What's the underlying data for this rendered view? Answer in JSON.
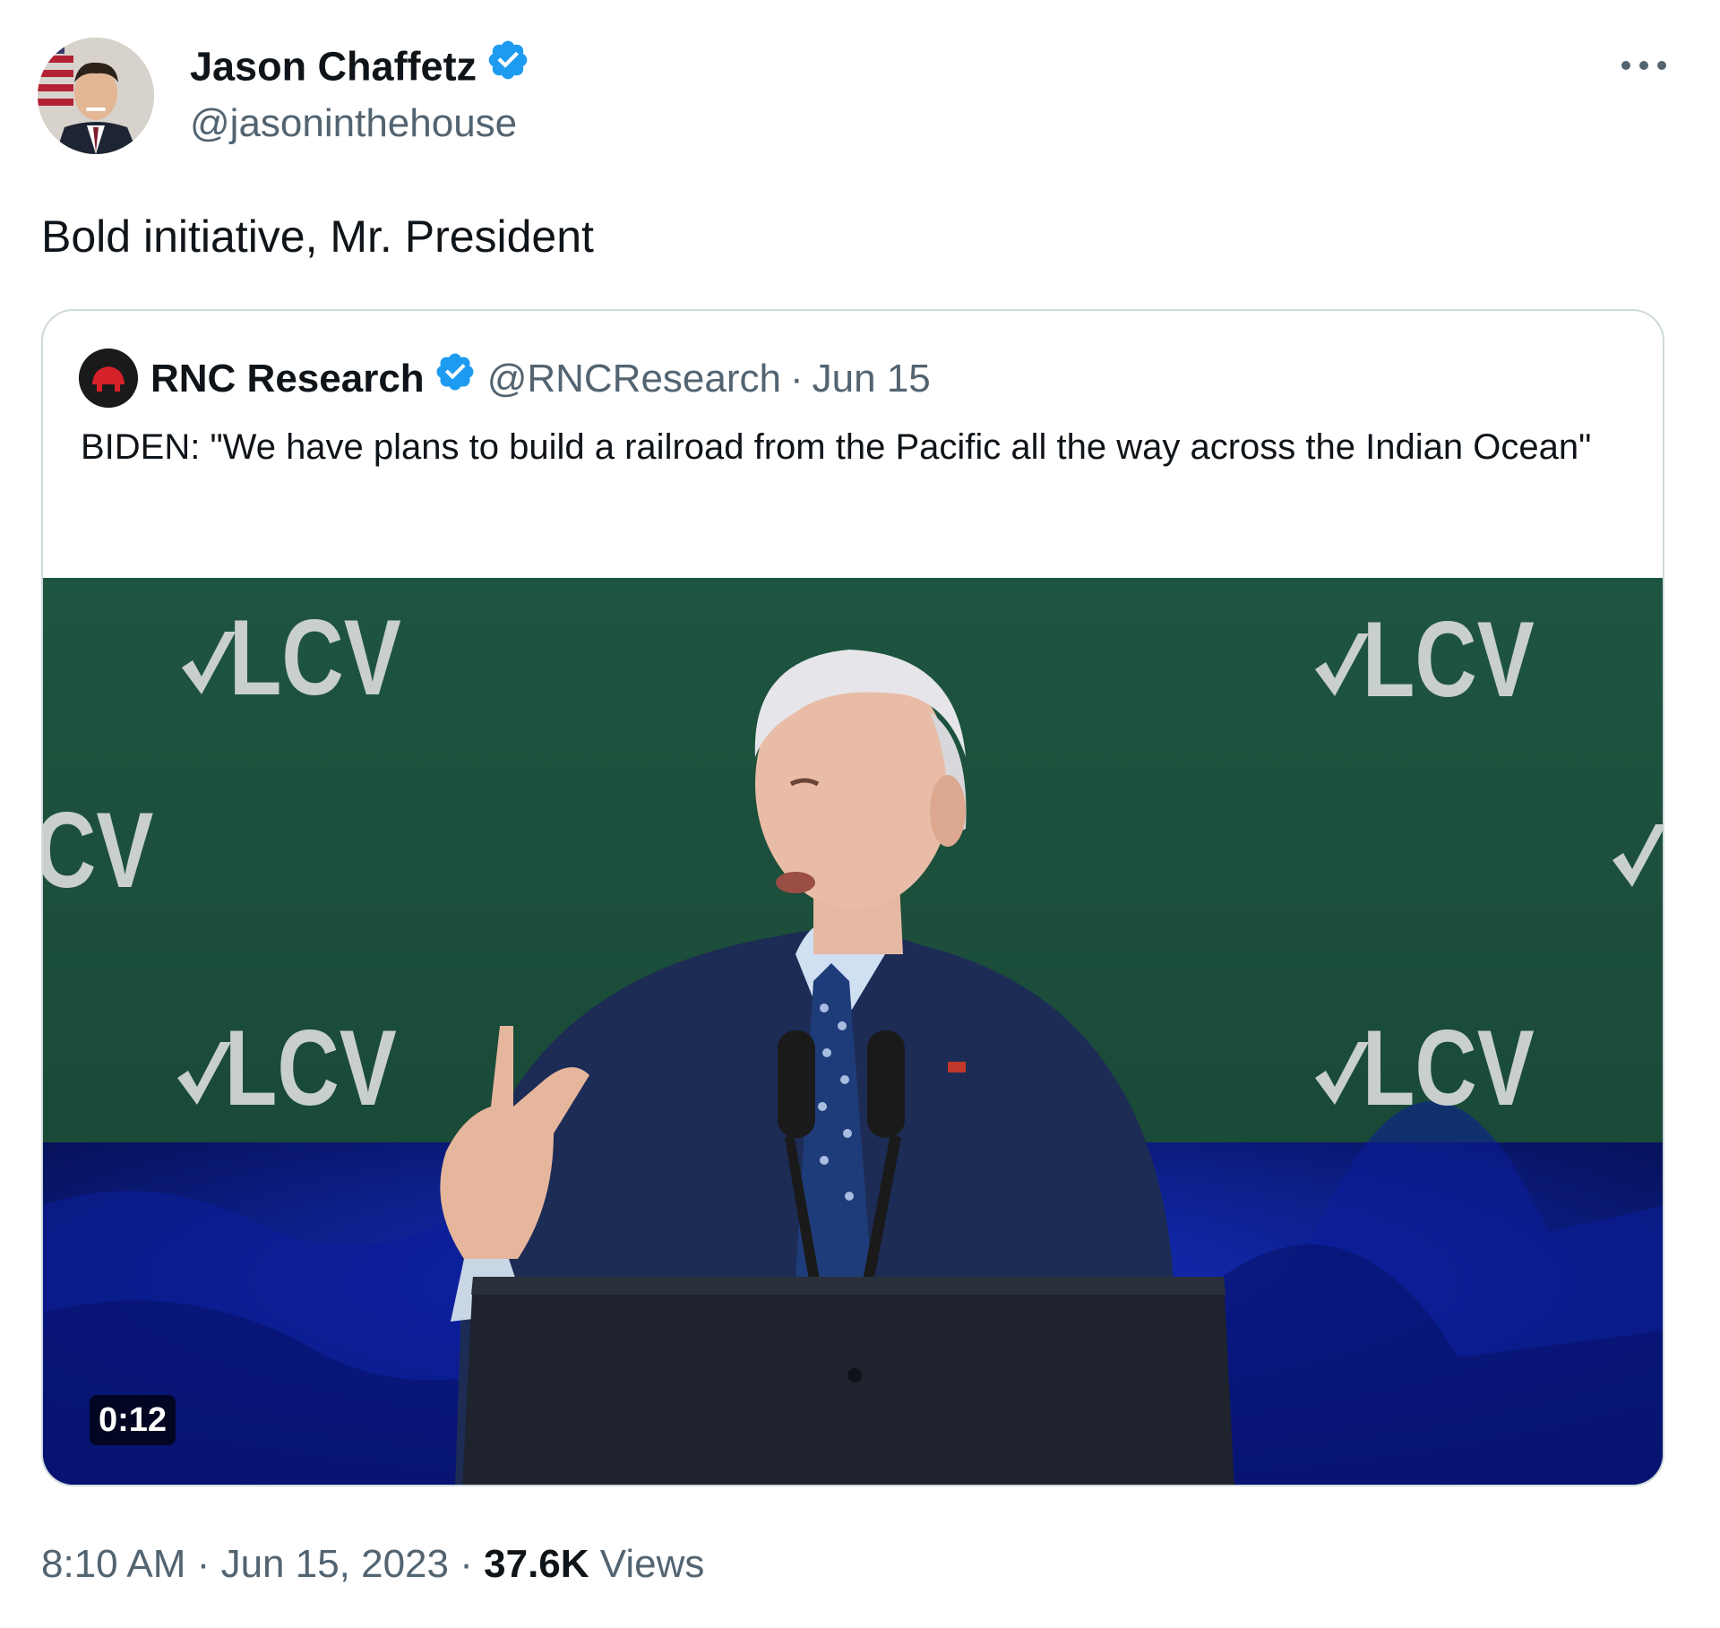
{
  "author": {
    "name": "Jason Chaffetz",
    "handle": "@jasoninthehouse",
    "verified": true
  },
  "tweet": {
    "text": "Bold initiative, Mr. President",
    "time": "8:10 AM",
    "date": "Jun 15, 2023",
    "views_count": "37.6K",
    "views_label": "Views",
    "separator": "·"
  },
  "quoted_tweet": {
    "author_name": "RNC Research",
    "author_handle": "@RNCResearch",
    "separator": "·",
    "date": "Jun 15",
    "verified": true,
    "text": "BIDEN: \"We have plans to build a railroad from the Pacific all the way across the Indian Ocean\"",
    "video": {
      "duration": "0:12",
      "banner_text": "LCV"
    }
  },
  "icons": {
    "more": "more-horizontal-icon",
    "verified": "verified-badge-icon"
  },
  "colors": {
    "text_primary": "#0f1419",
    "text_secondary": "#536471",
    "verified_blue": "#1d9bf0",
    "border": "#cfd9de",
    "banner_green": "#1f4f3c",
    "curtain_blue": "#0a1a7a"
  }
}
